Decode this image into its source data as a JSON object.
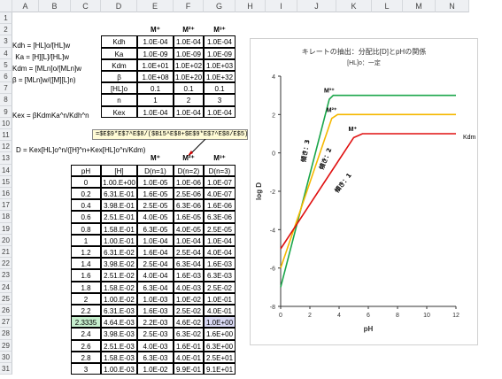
{
  "columns": [
    "A",
    "B",
    "C",
    "D",
    "E",
    "F",
    "G",
    "H",
    "I",
    "J",
    "K",
    "L",
    "M",
    "N"
  ],
  "rows": [
    "1",
    "2",
    "3",
    "4",
    "5",
    "6",
    "7",
    "8",
    "9",
    "10",
    "11",
    "12",
    "13",
    "14",
    "15",
    "16",
    "17",
    "18",
    "19",
    "20",
    "21",
    "22",
    "23",
    "24",
    "25",
    "26",
    "27",
    "28",
    "29",
    "30",
    "31"
  ],
  "labels": {
    "kdh": "Kdh = [HL]o/[HL]w",
    "ka": "Ka = [H][L]/[HL]w",
    "kdm": "Kdm = [MLn]o/[MLn]w",
    "beta": "β = [MLn]w/([M][L]n)",
    "kex": "Kex = βKdmKa^n/Kdh^n",
    "d_eq": "D = Kex[HL]o^n/([H]^n+Kex[HL]o^n/Kdm)"
  },
  "param_table": {
    "headers": [
      "M⁺",
      "M²⁺",
      "M³⁺"
    ],
    "rows": [
      {
        "name": "Kdh",
        "v": [
          "1.0E-04",
          "1.0E-04",
          "1.0E-04"
        ]
      },
      {
        "name": "Ka",
        "v": [
          "1.0E-09",
          "1.0E-09",
          "1.0E-09"
        ]
      },
      {
        "name": "Kdm",
        "v": [
          "1.0E+01",
          "1.0E+02",
          "1.0E+03"
        ]
      },
      {
        "name": "β",
        "v": [
          "1.0E+08",
          "1.0E+20",
          "1.0E+32"
        ]
      },
      {
        "name": "[HL]o",
        "v": [
          "0.1",
          "0.1",
          "0.1"
        ]
      },
      {
        "name": "n",
        "v": [
          "1",
          "2",
          "3"
        ]
      },
      {
        "name": "Kex",
        "v": [
          "1.0E-04",
          "1.0E-04",
          "1.0E-04"
        ]
      }
    ]
  },
  "formula_tooltip": "=$E$9*E$7^E$8/($B15^E$8+$E$9*E$7^E$8/E$5)",
  "data_table": {
    "group_headers": [
      "M⁺",
      "M²⁺",
      "M³⁺"
    ],
    "headers": [
      "pH",
      "[H]",
      "D(n=1)",
      "D(n=2)",
      "D(n=3)"
    ],
    "rows": [
      [
        "0",
        "1.00.E+00",
        "1.0E-05",
        "1.0E-06",
        "1.0E-07"
      ],
      [
        "0.2",
        "6.31.E-01",
        "1.6E-05",
        "2.5E-06",
        "4.0E-07"
      ],
      [
        "0.4",
        "3.98.E-01",
        "2.5E-05",
        "6.3E-06",
        "1.6E-06"
      ],
      [
        "0.6",
        "2.51.E-01",
        "4.0E-05",
        "1.6E-05",
        "6.3E-06"
      ],
      [
        "0.8",
        "1.58.E-01",
        "6.3E-05",
        "4.0E-05",
        "2.5E-05"
      ],
      [
        "1",
        "1.00.E-01",
        "1.0E-04",
        "1.0E-04",
        "1.0E-04"
      ],
      [
        "1.2",
        "6.31.E-02",
        "1.6E-04",
        "2.5E-04",
        "4.0E-04"
      ],
      [
        "1.4",
        "3.98.E-02",
        "2.5E-04",
        "6.3E-04",
        "1.6E-03"
      ],
      [
        "1.6",
        "2.51.E-02",
        "4.0E-04",
        "1.6E-03",
        "6.3E-03"
      ],
      [
        "1.8",
        "1.58.E-02",
        "6.3E-04",
        "4.0E-03",
        "2.5E-02"
      ],
      [
        "2",
        "1.00.E-02",
        "1.0E-03",
        "1.0E-02",
        "1.0E-01"
      ],
      [
        "2.2",
        "6.31.E-03",
        "1.6E-03",
        "2.5E-02",
        "4.0E-01"
      ],
      [
        "2.3335",
        "4.64.E-03",
        "2.2E-03",
        "4.6E-02",
        "1.0E+00"
      ],
      [
        "2.4",
        "3.98.E-03",
        "2.5E-03",
        "6.3E-02",
        "1.6E+00"
      ],
      [
        "2.6",
        "2.51.E-03",
        "4.0E-03",
        "1.6E-01",
        "6.3E+00"
      ],
      [
        "2.8",
        "1.58.E-03",
        "6.3E-03",
        "4.0E-01",
        "2.5E+01"
      ],
      [
        "3",
        "1.00.E-03",
        "1.0E-02",
        "9.9E-01",
        "9.1E+01"
      ]
    ]
  },
  "highlight": {
    "ph_cell_color": "#c6efce",
    "d3_cell_color": "#d9d9f3"
  },
  "chart_data": {
    "type": "line",
    "title": "キレートの抽出：分配比[D]とpHの関係",
    "subtitle": "[HL]o：一定",
    "xlabel": "pH",
    "ylabel": "log D",
    "xlim": [
      0,
      12
    ],
    "ylim": [
      -8,
      4
    ],
    "xticks": [
      0,
      2,
      4,
      6,
      8,
      10,
      12
    ],
    "yticks": [
      4,
      2,
      0,
      -2,
      -4,
      -6,
      -8
    ],
    "series": [
      {
        "name": "M³⁺",
        "color": "#1aa64a",
        "x": [
          0,
          3.33,
          3.6,
          12
        ],
        "y": [
          -7,
          2.8,
          3.0,
          3.0
        ]
      },
      {
        "name": "M²⁺",
        "color": "#f5b800",
        "x": [
          0,
          3.5,
          3.9,
          12
        ],
        "y": [
          -6,
          1.8,
          2.0,
          2.0
        ]
      },
      {
        "name": "M⁺",
        "color": "#e01010",
        "x": [
          0,
          5.0,
          5.6,
          12
        ],
        "y": [
          -5,
          0.8,
          1.0,
          1.0
        ]
      }
    ],
    "annotations": [
      "傾き：3",
      "傾き：2",
      "傾き：1",
      "Kdm"
    ]
  }
}
